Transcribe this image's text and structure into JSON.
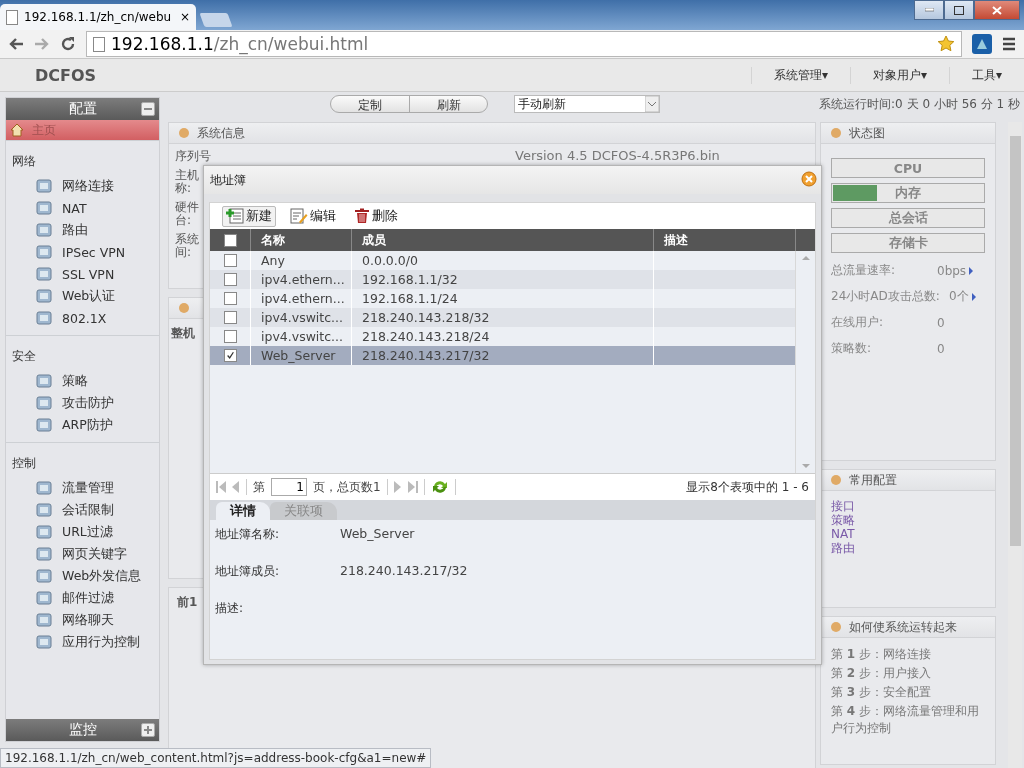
{
  "browser": {
    "tab_title": "192.168.1.1/zh_cn/webu",
    "tab_close": "×",
    "url_host": "192.168.1.1",
    "url_path": "/zh_cn/webui.html",
    "status_url": "192.168.1.1/zh_cn/web_content.html?js=address-book-cfg&a1=new#"
  },
  "header": {
    "logo": "DCFOS",
    "menus": [
      {
        "label": "系统管理",
        "arrow": "▾"
      },
      {
        "label": "对象用户",
        "arrow": "▾"
      },
      {
        "label": "工具",
        "arrow": "▾"
      }
    ]
  },
  "toolbar": {
    "buttons": [
      "定制",
      "刷新"
    ],
    "refresh_select": {
      "value": "手动刷新"
    },
    "uptime": "系统运行时间:0 天 0 小时 56 分 1 秒"
  },
  "sidebar": {
    "title": "配置",
    "home": {
      "label": "主页",
      "selected": true
    },
    "sections": [
      {
        "title": "网络",
        "items": [
          {
            "label": "网络连接",
            "selected": false
          },
          {
            "label": "NAT",
            "selected": false
          },
          {
            "label": "路由",
            "selected": false
          },
          {
            "label": "IPSec VPN",
            "selected": false
          },
          {
            "label": "SSL VPN",
            "selected": false
          },
          {
            "label": "Web认证",
            "selected": false
          },
          {
            "label": "802.1X",
            "selected": false
          }
        ]
      },
      {
        "title": "安全",
        "items": [
          {
            "label": "策略",
            "selected": false
          },
          {
            "label": "攻击防护",
            "selected": false
          },
          {
            "label": "ARP防护",
            "selected": false
          }
        ]
      },
      {
        "title": "控制",
        "items": [
          {
            "label": "流量管理",
            "selected": false
          },
          {
            "label": "会话限制",
            "selected": false
          },
          {
            "label": "URL过滤",
            "selected": false
          },
          {
            "label": "网页关键字",
            "selected": false
          },
          {
            "label": "Web外发信息",
            "selected": false
          },
          {
            "label": "邮件过滤",
            "selected": false
          },
          {
            "label": "网络聊天",
            "selected": false
          },
          {
            "label": "应用行为控制",
            "selected": false
          }
        ]
      }
    ],
    "footer_title": "监控"
  },
  "system_info": {
    "title": "系统信息",
    "labels": [
      [
        "序列号"
      ],
      [
        "主机",
        "称:"
      ],
      [
        "硬件",
        "台:"
      ],
      [
        "系统",
        "间:"
      ]
    ],
    "version": "Version 4.5 DCFOS-4.5R3P6.bin"
  },
  "panel_2": {
    "label": "整机"
  },
  "panel_3": {
    "label": "前1"
  },
  "dialog": {
    "title": "地址簿",
    "actions": [
      {
        "label": "新建",
        "kind": "new"
      },
      {
        "label": "编辑",
        "kind": "edit"
      },
      {
        "label": "删除",
        "kind": "delete"
      }
    ],
    "table": {
      "all_checked": false,
      "columns": [
        "名称",
        "成员",
        "描述"
      ],
      "rows": [
        {
          "name": "Any",
          "member": "0.0.0.0/0",
          "checked": false,
          "selected": false
        },
        {
          "name": "ipv4.ethern...",
          "member": "192.168.1.1/32",
          "checked": false,
          "selected": false
        },
        {
          "name": "ipv4.ethern...",
          "member": "192.168.1.1/24",
          "checked": false,
          "selected": false
        },
        {
          "name": "ipv4.vswitc...",
          "member": "218.240.143.218/32",
          "checked": false,
          "selected": false
        },
        {
          "name": "ipv4.vswitc...",
          "member": "218.240.143.218/24",
          "checked": false,
          "selected": false
        },
        {
          "name": "Web_Server",
          "member": "218.240.143.217/32",
          "checked": true,
          "selected": true
        }
      ]
    },
    "pager": {
      "prefix": "第",
      "page": "1",
      "suffix": "页，总页数1",
      "summary": "显示8个表项中的 1 - 6"
    },
    "tabs": [
      {
        "label": "详情",
        "selected": true
      },
      {
        "label": "关联项",
        "selected": false
      }
    ],
    "details": [
      {
        "label": "地址簿名称:",
        "value": "Web_Server"
      },
      {
        "label": "地址簿成员:",
        "value": "218.240.143.217/32"
      },
      {
        "label": "描述:"
      }
    ]
  },
  "status": {
    "title": "状态图",
    "meters": [
      {
        "label": "CPU"
      },
      {
        "label": "内存",
        "level": 0.29
      },
      {
        "label": "总会话"
      },
      {
        "label": "存储卡"
      }
    ],
    "stats": [
      {
        "label": "总流量速率:",
        "value": "0bps",
        "link": true
      },
      {
        "label": "24小时AD攻击总数:",
        "value": "0个",
        "link": true
      },
      {
        "label": "在线用户:",
        "value": "0",
        "link": false
      },
      {
        "label": "策略数:",
        "value": "0",
        "link": false
      }
    ]
  },
  "common_config": {
    "title": "常用配置",
    "links": [
      "接口",
      "策略",
      "NAT",
      "路由"
    ]
  },
  "how_to": {
    "title": "如何使系统运转起来",
    "steps": [
      "第 **1** 步：网络连接",
      "第 **2** 步：用户接入",
      "第 **3** 步：安全配置",
      "第 **4** 步：网络流量管理和用户行为控制"
    ]
  }
}
